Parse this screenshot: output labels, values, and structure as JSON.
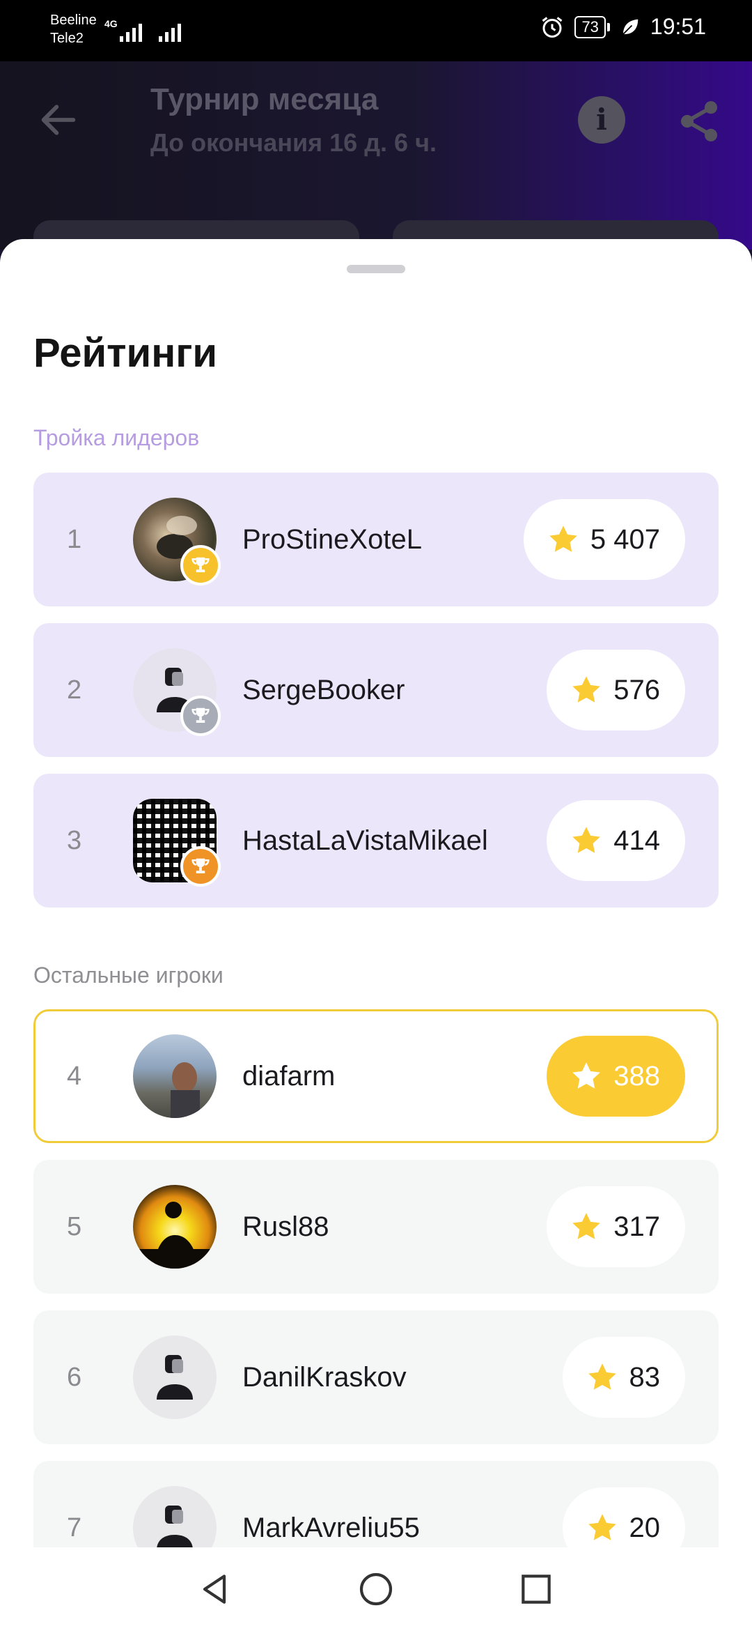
{
  "status_bar": {
    "carrier1": "Beeline",
    "carrier2": "Tele2",
    "network": "4G",
    "battery": "73",
    "time": "19:51"
  },
  "header": {
    "title": "Турнир месяца",
    "subtitle": "До окончания 16 д. 6 ч.",
    "info_glyph": "i"
  },
  "sheet": {
    "title": "Рейтинги",
    "leaders_label": "Тройка лидеров",
    "others_label": "Остальные игроки"
  },
  "leaders": [
    {
      "rank": "1",
      "name": "ProStineXoteL",
      "score": "5 407",
      "trophy": "gold"
    },
    {
      "rank": "2",
      "name": "SergeBooker",
      "score": "576",
      "trophy": "silver"
    },
    {
      "rank": "3",
      "name": "HastaLaVistaMikael",
      "score": "414",
      "trophy": "bronze"
    }
  ],
  "players": [
    {
      "rank": "4",
      "name": "diafarm",
      "score": "388",
      "is_current_user": true
    },
    {
      "rank": "5",
      "name": "Rusl88",
      "score": "317"
    },
    {
      "rank": "6",
      "name": "DanilKraskov",
      "score": "83"
    },
    {
      "rank": "7",
      "name": "MarkAvreliu55",
      "score": "20"
    }
  ],
  "colors": {
    "accent_yellow": "#fbcb33",
    "leaders_bg": "#ece6fb",
    "others_bg": "#f5f6f6",
    "leaders_label": "#b69ce0"
  },
  "icons": [
    "back-arrow-icon",
    "info-icon",
    "share-icon",
    "star-icon",
    "trophy-icon",
    "default-avatar-icon"
  ]
}
